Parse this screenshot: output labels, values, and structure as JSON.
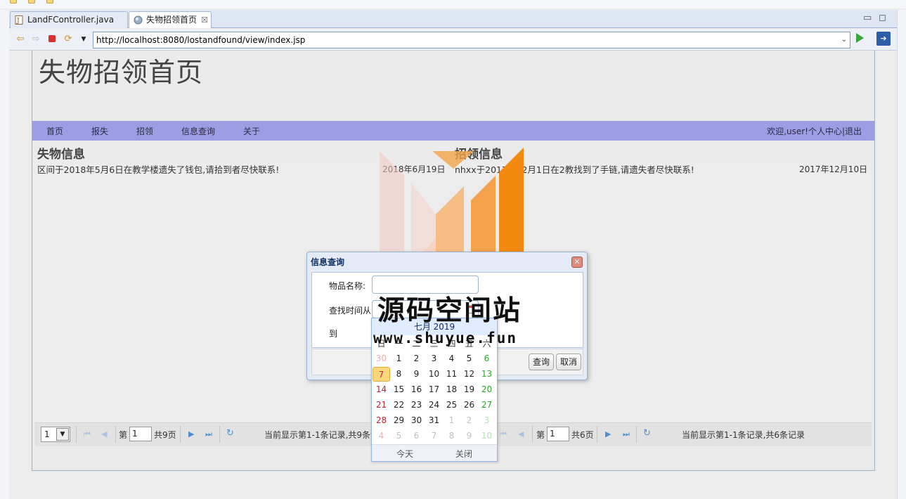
{
  "ide": {
    "tabs": [
      {
        "label": "LandFController.java",
        "icon": "java-file-icon",
        "active": false
      },
      {
        "label": "失物招领首页",
        "icon": "globe-icon",
        "active": true,
        "close": "☒"
      }
    ],
    "url": "http://localhost:8080/lostandfound/view/index.jsp"
  },
  "page": {
    "title": "失物招领首页",
    "menu": [
      "首页",
      "报失",
      "招领",
      "信息查询",
      "关于"
    ],
    "user_area": "欢迎,user!个人中心|退出"
  },
  "lost": {
    "heading": "失物信息",
    "row_text": "区间于2018年5月6日在教学楼遗失了钱包,请拾到者尽快联系!",
    "row_date": "2018年6月19日",
    "pager": {
      "page_size": "1",
      "page_prefix": "第",
      "page_value": "1",
      "page_total": "共9页",
      "summary": "当前显示第1-1条记录,共9条记录"
    }
  },
  "found": {
    "heading": "招领信息",
    "row_text": "nhxx于2017年12月1日在2教找到了手链,请遗失者尽快联系!",
    "row_date": "2017年12月10日",
    "pager": {
      "page_prefix": "第",
      "page_value": "1",
      "page_total": "共6页",
      "summary": "当前显示第1-1条记录,共6条记录"
    }
  },
  "dialog": {
    "title": "信息查询",
    "item_label": "物品名称:",
    "time_from_label": "查找时间从",
    "time_to_label": "到",
    "query_button": "查询",
    "cancel_button": "取消"
  },
  "calendar": {
    "header": "七月 2019",
    "weekdays": [
      "日",
      "一",
      "二",
      "三",
      "四",
      "五",
      "六"
    ],
    "weeks": [
      [
        "30",
        "1",
        "2",
        "3",
        "4",
        "5",
        "6"
      ],
      [
        "7",
        "8",
        "9",
        "10",
        "11",
        "12",
        "13"
      ],
      [
        "14",
        "15",
        "16",
        "17",
        "18",
        "19",
        "20"
      ],
      [
        "21",
        "22",
        "23",
        "24",
        "25",
        "26",
        "27"
      ],
      [
        "28",
        "29",
        "30",
        "31",
        "1",
        "2",
        "3"
      ],
      [
        "4",
        "5",
        "6",
        "7",
        "8",
        "9",
        "10"
      ]
    ],
    "today_label": "今天",
    "close_label": "关闭",
    "selected_day": "7"
  },
  "watermark": {
    "title": "源码空间站",
    "url": "www.shuyue.fun"
  }
}
